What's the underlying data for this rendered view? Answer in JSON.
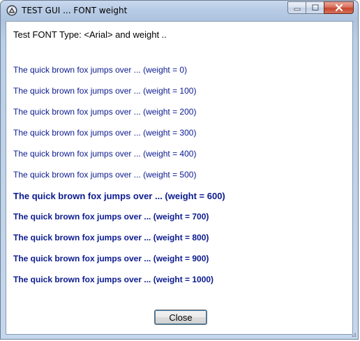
{
  "window": {
    "title": "TEST GUI ... FONT weight"
  },
  "content": {
    "heading": "Test FONT Type: <Arial> and weight ..",
    "samples": [
      {
        "text": "The quick brown fox jumps over ... (weight = 0)",
        "weight": 0
      },
      {
        "text": "The quick brown fox jumps over ... (weight = 100)",
        "weight": 100
      },
      {
        "text": "The quick brown fox jumps over ... (weight = 200)",
        "weight": 200
      },
      {
        "text": "The quick brown fox jumps over ... (weight = 300)",
        "weight": 300
      },
      {
        "text": "The quick brown fox jumps over ... (weight = 400)",
        "weight": 400
      },
      {
        "text": "The quick brown fox jumps over ... (weight = 500)",
        "weight": 500
      },
      {
        "text": "The quick brown fox jumps over ... (weight = 600)",
        "weight": 600
      },
      {
        "text": "The quick brown fox jumps over ... (weight = 700)",
        "weight": 700
      },
      {
        "text": "The quick brown fox jumps over ... (weight = 800)",
        "weight": 800
      },
      {
        "text": "The quick brown fox jumps over ... (weight = 900)",
        "weight": 900
      },
      {
        "text": "The quick brown fox jumps over ... (weight = 1000)",
        "weight": 1000
      }
    ]
  },
  "buttons": {
    "close_label": "Close"
  },
  "icons": {
    "app": "autoit-app-icon",
    "minimize": "minimize-icon",
    "maximize": "maximize-icon",
    "close": "close-icon"
  },
  "colors": {
    "sample_text": "#0b1a8f",
    "close_button_accent": "#c8462e"
  }
}
